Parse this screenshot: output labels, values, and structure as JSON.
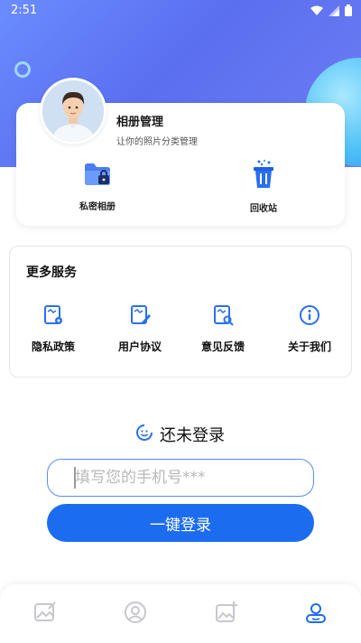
{
  "status_bar": {
    "time": "2:51"
  },
  "album_card": {
    "title": "相册管理",
    "subtitle": "让你的照片分类管理",
    "actions": [
      {
        "label": "私密相册",
        "icon": "folder-lock-icon"
      },
      {
        "label": "回收站",
        "icon": "trash-icon"
      }
    ]
  },
  "services": {
    "title": "更多服务",
    "items": [
      {
        "label": "隐私政策",
        "icon": "privacy-document-icon"
      },
      {
        "label": "用户协议",
        "icon": "agreement-document-icon"
      },
      {
        "label": "意见反馈",
        "icon": "feedback-document-icon"
      },
      {
        "label": "关于我们",
        "icon": "info-icon"
      }
    ]
  },
  "login": {
    "status_text": "还未登录",
    "phone_placeholder": "填写您的手机号***",
    "button_label": "一键登录"
  },
  "tabbar": {
    "items": [
      {
        "icon": "photo-edit-icon",
        "active": false
      },
      {
        "icon": "face-icon",
        "active": false
      },
      {
        "icon": "image-add-icon",
        "active": false
      },
      {
        "icon": "user-icon",
        "active": true
      }
    ]
  },
  "colors": {
    "accent": "#1c6cf0",
    "hero_start": "#6b8cff",
    "hero_end": "#6f7df3"
  }
}
